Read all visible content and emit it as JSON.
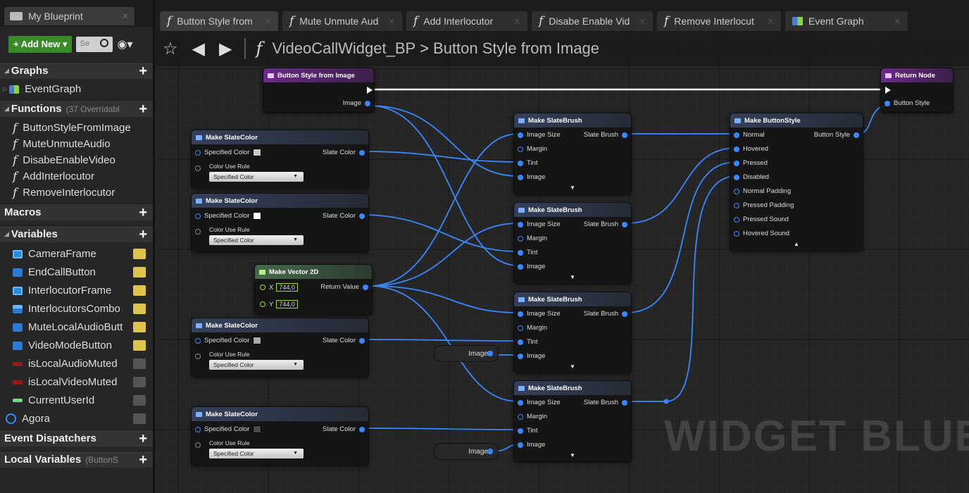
{
  "left_panel": {
    "tab_title": "My Blueprint",
    "add_new_label": "+ Add New ▾",
    "search_placeholder": "Se",
    "sections": {
      "graphs": {
        "label": "Graphs",
        "items": [
          "EventGraph"
        ]
      },
      "functions": {
        "label": "Functions",
        "sub": "(37 Overridabl",
        "items": [
          "ButtonStyleFromImage",
          "MuteUnmuteAudio",
          "DisabeEnableVideo",
          "AddInterlocutor",
          "RemoveInterlocutor"
        ]
      },
      "macros": {
        "label": "Macros"
      },
      "variables": {
        "label": "Variables",
        "items": [
          "CameraFrame",
          "EndCallButton",
          "InterlocutorFrame",
          "InterlocutorsCombo",
          "MuteLocalAudioButt",
          "VideoModeButton",
          "isLocalAudioMuted",
          "isLocalVideoMuted",
          "CurrentUserId",
          "Agora"
        ]
      },
      "dispatchers": {
        "label": "Event Dispatchers"
      },
      "locals": {
        "label": "Local Variables",
        "sub": "(ButtonS"
      }
    }
  },
  "tabs": [
    "Button Style from",
    "Mute Unmute Aud",
    "Add Interlocutor",
    "Disabe Enable Vid",
    "Remove Interlocut",
    "Event Graph"
  ],
  "breadcrumb": {
    "blueprint": "VideoCallWidget_BP",
    "separator": ">",
    "function": "Button Style from Image"
  },
  "watermark": "WIDGET BLUEI",
  "nodes": {
    "entry": {
      "title": "Button Style from Image",
      "pin": "Image"
    },
    "return": {
      "title": "Return Node",
      "pin": "Button Style"
    },
    "slate_color": {
      "title": "Make SlateColor",
      "in_pin": "Specified Color",
      "out_pin": "Slate Color",
      "rule_label": "Color Use Rule",
      "rule_value": "Specified Color"
    },
    "vector2d": {
      "title": "Make Vector 2D",
      "x_label": "X",
      "x_value": "744,0",
      "y_label": "Y",
      "y_value": "744,0",
      "out_pin": "Return Value"
    },
    "slate_brush": {
      "title": "Make SlateBrush",
      "pins": [
        "Image Size",
        "Margin",
        "Tint",
        "Image"
      ],
      "out_pin": "Slate Brush"
    },
    "button_style": {
      "title": "Make ButtonStyle",
      "pins": [
        "Normal",
        "Hovered",
        "Pressed",
        "Disabled",
        "Normal Padding",
        "Pressed Padding",
        "Pressed Sound",
        "Hovered Sound"
      ],
      "out_pin": "Button Style"
    },
    "image_reroute": {
      "label": "Image"
    }
  },
  "colors": {
    "accent_blue": "#3a88ff",
    "vector_green": "#9ede35",
    "function_purple": "#6b2a8a",
    "add_new_green": "#3b8a2a"
  }
}
